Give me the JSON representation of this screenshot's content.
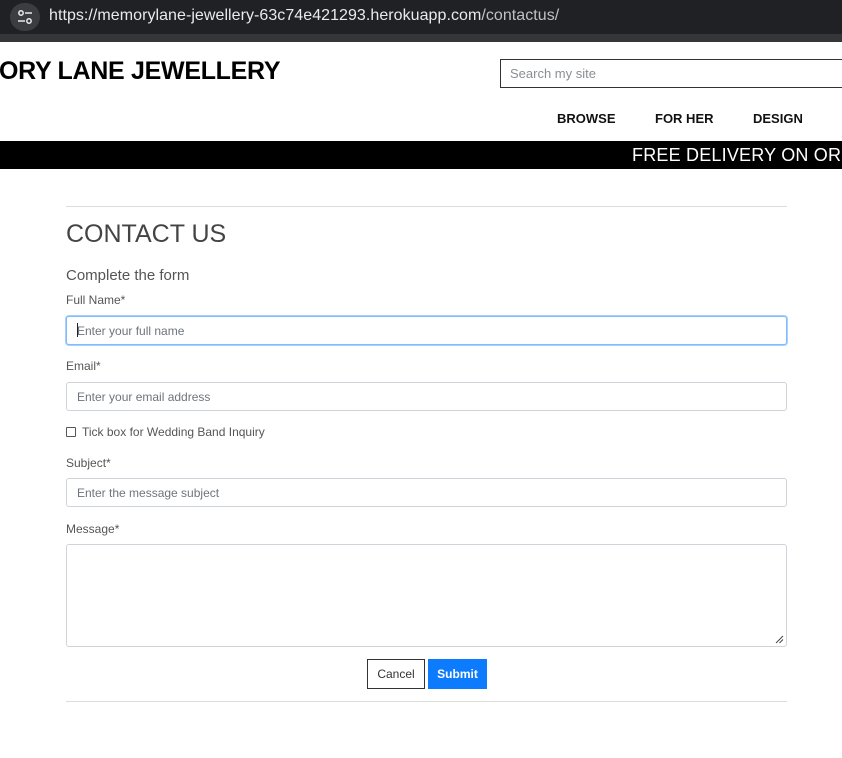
{
  "browser": {
    "url_host": "https://memorylane-jewellery-63c74e421293.herokuapp.com",
    "url_path": "/contactus/"
  },
  "header": {
    "logo_text": "ORY LANE JEWELLERY",
    "search_placeholder": "Search my site",
    "nav": [
      "BROWSE",
      "FOR HER",
      "DESIGN"
    ]
  },
  "banner": {
    "text": "FREE DELIVERY ON ORDE"
  },
  "form": {
    "title": "CONTACT US",
    "subtitle": "Complete the form",
    "full_name_label": "Full Name*",
    "full_name_placeholder": "Enter your full name",
    "email_label": "Email*",
    "email_placeholder": "Enter your email address",
    "wedding_checkbox_label": "Tick box for Wedding Band Inquiry",
    "wedding_checkbox_checked": false,
    "subject_label": "Subject*",
    "subject_placeholder": "Enter the message subject",
    "message_label": "Message*",
    "cancel_label": "Cancel",
    "submit_label": "Submit"
  },
  "colors": {
    "submit_bg": "#0d7bfd",
    "banner_bg": "#000000",
    "focus_border": "#80bdff"
  }
}
